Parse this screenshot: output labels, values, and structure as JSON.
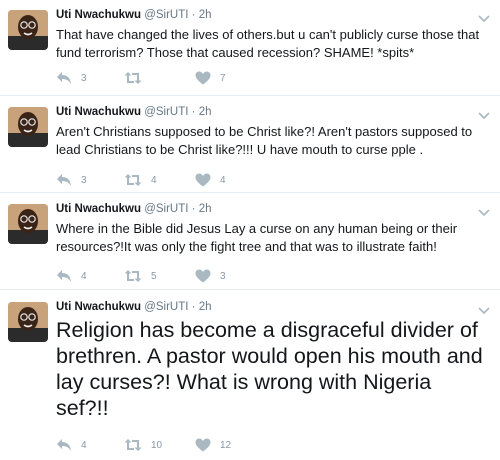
{
  "author": {
    "name": "Uti Nwachukwu",
    "handle": "@SirUTI",
    "separator": "·"
  },
  "colors": {
    "text": "#14171a",
    "meta": "#657786",
    "icon": "#aab8c2",
    "divider": "#e6ecf0"
  },
  "tweets": [
    {
      "time": "2h",
      "text": "That have changed the lives of others.but u can't publicly curse those that fund terrorism? Those that caused recession? SHAME! *spits*",
      "replies": "3",
      "retweets": "",
      "likes": "7"
    },
    {
      "time": "2h",
      "text": "Aren't Christians supposed to be Christ like?! Aren't pastors supposed to lead Christians to be Christ like?!!! U have mouth to curse pple .",
      "replies": "3",
      "retweets": "4",
      "likes": "4"
    },
    {
      "time": "2h",
      "text": "Where in the Bible did Jesus Lay a curse on any human being or their resources?!It was only the fight tree and that was to illustrate faith!",
      "replies": "4",
      "retweets": "5",
      "likes": "3"
    },
    {
      "time": "2h",
      "text": "Religion has become a disgraceful divider of brethren. A pastor would open his mouth and lay curses?! What is wrong with Nigeria sef?!!",
      "replies": "4",
      "retweets": "10",
      "likes": "12"
    }
  ]
}
